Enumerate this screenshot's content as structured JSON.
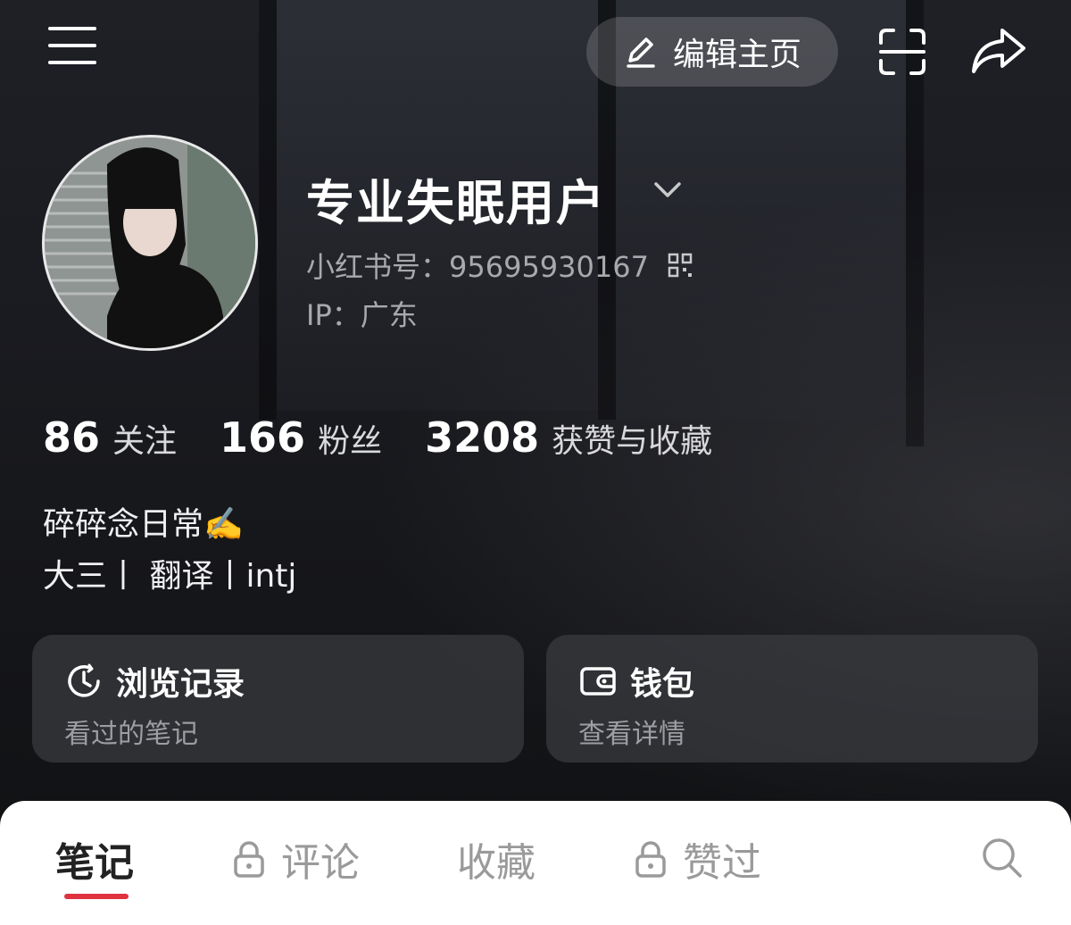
{
  "header": {
    "edit_label": "编辑主页"
  },
  "profile": {
    "name": "专业失眠用户",
    "red_id": "小红书号：95695930167",
    "ip": "IP：广东"
  },
  "stats": [
    {
      "num": "86",
      "label": "关注"
    },
    {
      "num": "166",
      "label": "粉丝"
    },
    {
      "num": "3208",
      "label": "获赞与收藏"
    }
  ],
  "bio": {
    "line1": "碎碎念日常✍️",
    "line2": "大三丨 翻译丨intj"
  },
  "cards": [
    {
      "title": "浏览记录",
      "subtitle": "看过的笔记"
    },
    {
      "title": "钱包",
      "subtitle": "查看详情"
    }
  ],
  "tabs": [
    {
      "label": "笔记",
      "active": true,
      "locked": false
    },
    {
      "label": "评论",
      "active": false,
      "locked": true
    },
    {
      "label": "收藏",
      "active": false,
      "locked": false
    },
    {
      "label": "赞过",
      "active": false,
      "locked": true
    }
  ],
  "colors": {
    "accent": "#e0313f",
    "background": "#17181c"
  }
}
